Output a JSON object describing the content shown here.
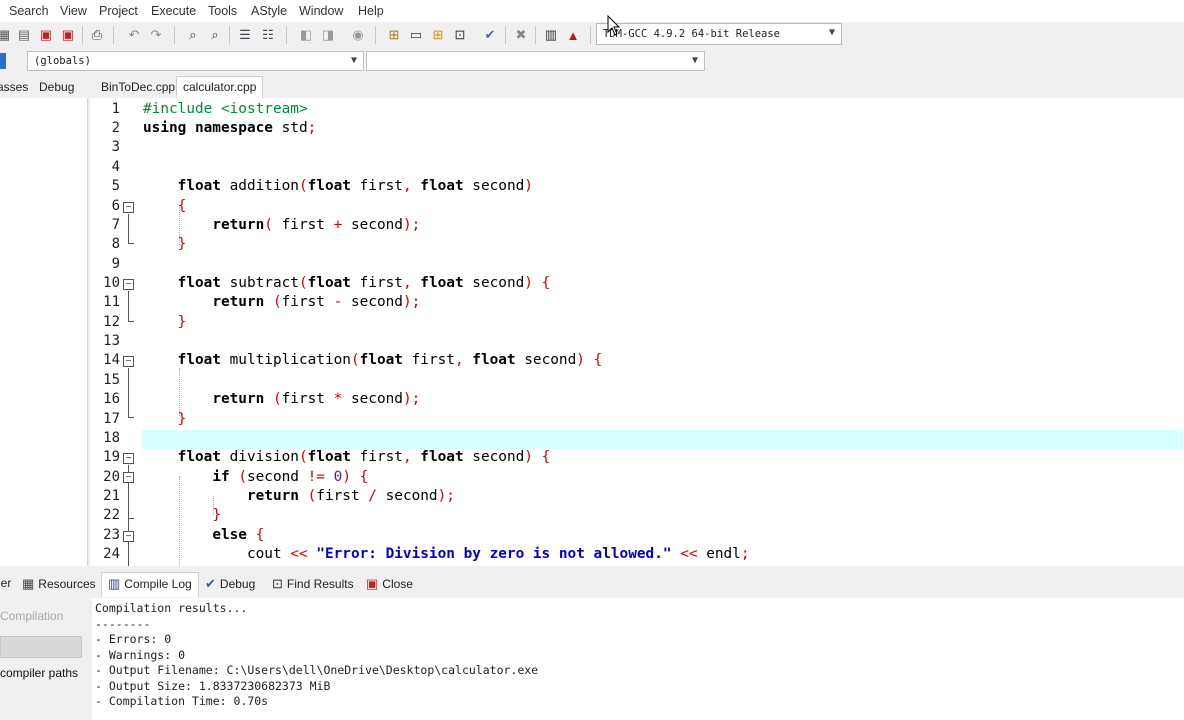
{
  "menu": [
    "Search",
    "View",
    "Project",
    "Execute",
    "Tools",
    "AStyle",
    "Window",
    "Help"
  ],
  "toolbar": {
    "compiler": "TDM-GCC 4.9.2 64-bit Release"
  },
  "scope_select": "(globals)",
  "member_select": "",
  "left_tabs": [
    "asses",
    "Debug"
  ],
  "editor_tabs": [
    "BinToDec.cpp",
    "calculator.cpp"
  ],
  "active_tab": "calculator.cpp",
  "line_numbers": [
    "1",
    "2",
    "3",
    "4",
    "5",
    "6",
    "7",
    "8",
    "9",
    "10",
    "11",
    "12",
    "13",
    "14",
    "15",
    "16",
    "17",
    "18",
    "19",
    "20",
    "21",
    "22",
    "23",
    "24"
  ],
  "current_line": 18,
  "bottom_tabs": [
    "ler",
    "Resources",
    "Compile Log",
    "Debug",
    "Find Results",
    "Close"
  ],
  "bottom_left": {
    "abort_label": "Compilation",
    "paths_label": "compiler paths"
  },
  "compile_log": [
    "Compilation results...",
    "--------",
    "- Errors: 0",
    "- Warnings: 0",
    "- Output Filename: C:\\Users\\dell\\OneDrive\\Desktop\\calculator.exe",
    "- Output Size: 1.8337230682373 MiB",
    "- Compilation Time: 0.70s"
  ],
  "colors": {
    "keyword": "#000000",
    "symbol": "#d40000",
    "preprocessor": "#008a3c",
    "string": "#0000c8",
    "number": "#6b0ea8",
    "current_line_bg": "#d8ffff"
  }
}
